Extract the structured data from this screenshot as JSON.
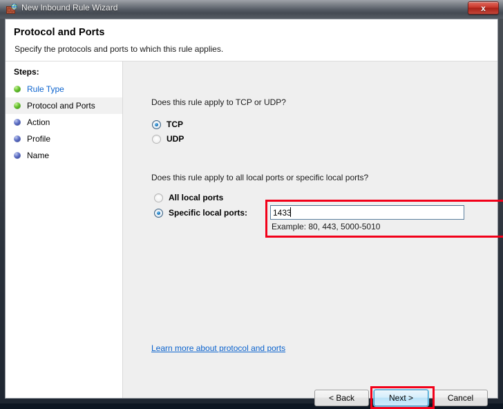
{
  "window": {
    "title": "New Inbound Rule Wizard",
    "icon": "firewall-brick-globe-icon",
    "close_label": "x"
  },
  "header": {
    "title": "Protocol and Ports",
    "subtitle": "Specify the protocols and ports to which this rule applies."
  },
  "sidebar": {
    "title": "Steps:",
    "items": [
      {
        "label": "Rule Type",
        "state": "done",
        "is_link": true,
        "current": false
      },
      {
        "label": "Protocol and Ports",
        "state": "done",
        "is_link": false,
        "current": true
      },
      {
        "label": "Action",
        "state": "pending",
        "is_link": false,
        "current": false
      },
      {
        "label": "Profile",
        "state": "pending",
        "is_link": false,
        "current": false
      },
      {
        "label": "Name",
        "state": "pending",
        "is_link": false,
        "current": false
      }
    ]
  },
  "main": {
    "protocol_question": "Does this rule apply to TCP or UDP?",
    "protocol_options": [
      {
        "label": "TCP",
        "selected": true
      },
      {
        "label": "UDP",
        "selected": false
      }
    ],
    "ports_question": "Does this rule apply to all local ports or specific local ports?",
    "ports_options": [
      {
        "label": "All local ports",
        "selected": false
      },
      {
        "label": "Specific local ports:",
        "selected": true
      }
    ],
    "ports_input_value": "1433",
    "ports_input_placeholder": "",
    "ports_hint": "Example: 80, 443, 5000-5010",
    "learn_more_link": "Learn more about protocol and ports"
  },
  "footer": {
    "back_label": "< Back",
    "next_label": "Next >",
    "cancel_label": "Cancel"
  },
  "annotations": {
    "color": "#f20019",
    "targets": [
      "specific-local-ports-row",
      "next-button"
    ]
  },
  "colors": {
    "link": "#0b63ce",
    "annotation_red": "#f20019",
    "default_button_blue": "#b9e2f8",
    "content_bg": "#efefef",
    "sidebar_bg": "#ffffff"
  }
}
